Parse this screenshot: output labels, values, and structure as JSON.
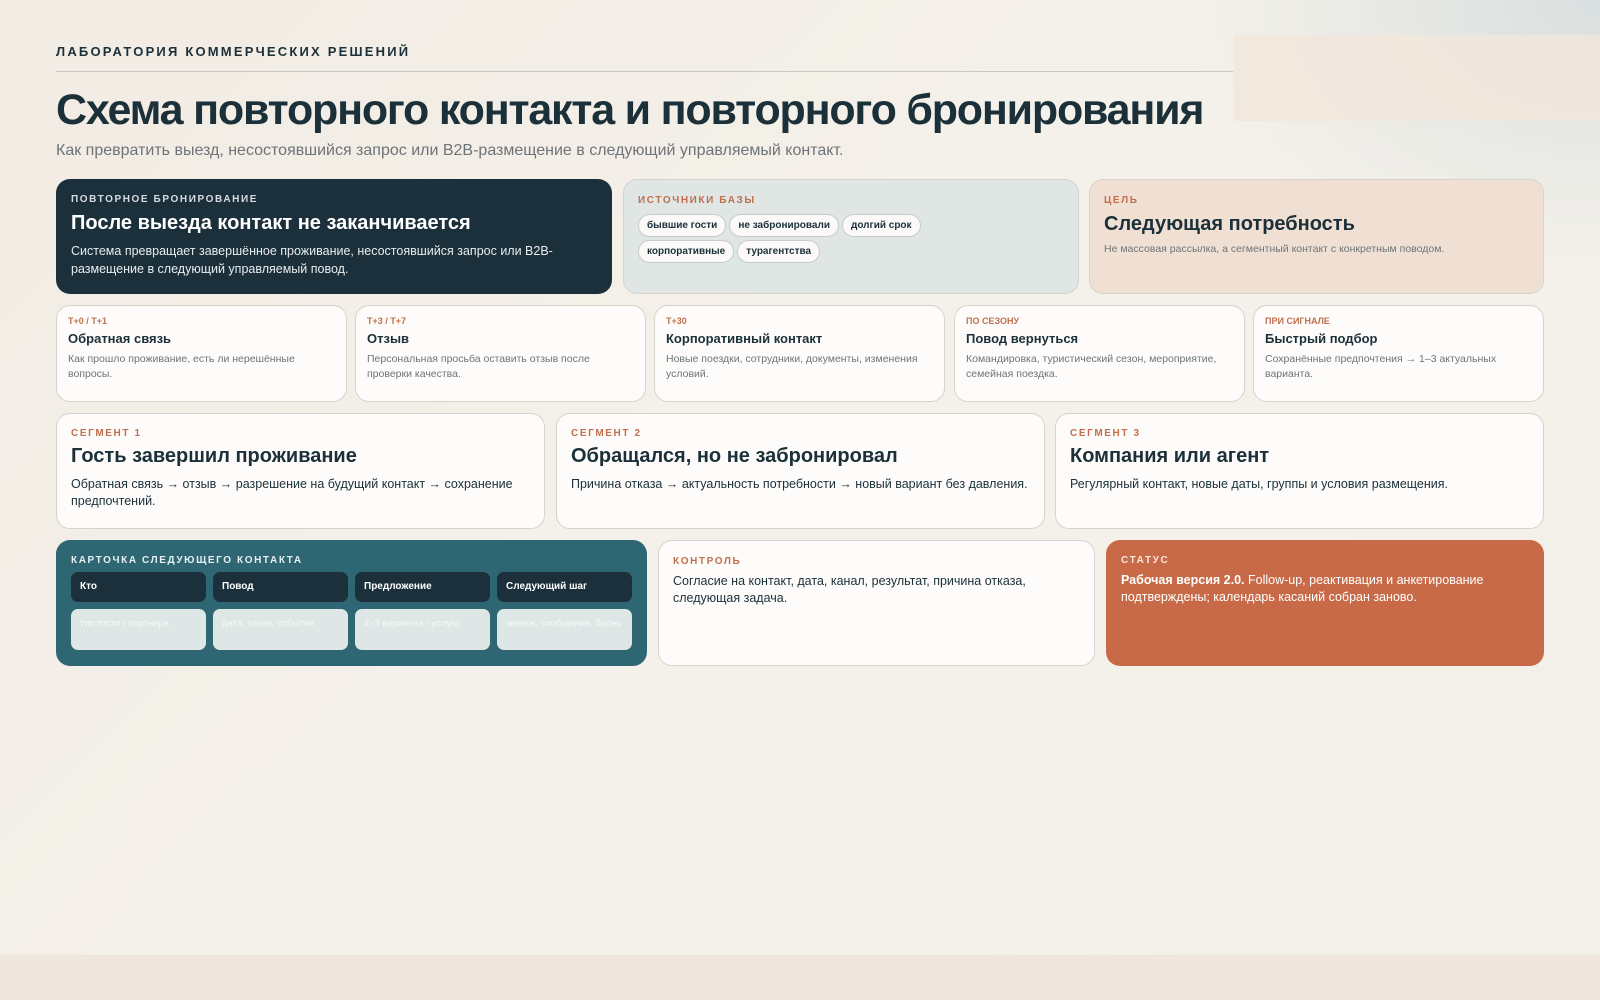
{
  "header": {
    "eyebrow": "ЛАБОРАТОРИЯ КОММЕРЧЕСКИХ РЕШЕНИЙ",
    "title": "Схема повторного контакта и повторного бронирования",
    "subtitle": "Как превратить выезд, несостоявшийся запрос или B2B-размещение в следующий управляемый контакт."
  },
  "hero": {
    "label": "ПОВТОРНОЕ БРОНИРОВАНИЕ",
    "title": "После выезда контакт не заканчивается",
    "text": "Система превращает завершённое проживание, несостоявшийся запрос или B2B-размещение в следующий управляемый повод."
  },
  "sources": {
    "label": "ИСТОЧНИКИ БАЗЫ",
    "chips": [
      "бывшие гости",
      "не забронировали",
      "долгий срок",
      "корпоративные",
      "турагентства"
    ]
  },
  "goal": {
    "label": "ЦЕЛЬ",
    "title": "Следующая потребность",
    "text": "Не массовая рассылка, а сегментный контакт с конкретным поводом."
  },
  "steps": [
    {
      "label": "T+0 / T+1",
      "title": "Обратная связь",
      "text": "Как прошло проживание, есть ли нерешённые вопросы."
    },
    {
      "label": "T+3 / T+7",
      "title": "Отзыв",
      "text": "Персональная просьба оставить отзыв после проверки качества."
    },
    {
      "label": "T+30",
      "title": "Корпоративный контакт",
      "text": "Новые поездки, сотрудники, документы, изменения условий."
    },
    {
      "label": "ПО СЕЗОНУ",
      "title": "Повод вернуться",
      "text": "Командировка, туристический сезон, мероприятие, семейная поездка."
    },
    {
      "label": "ПРИ СИГНАЛЕ",
      "title": "Быстрый подбор",
      "text": "Сохранённые предпочтения → 1–3 актуальных варианта."
    }
  ],
  "segments": [
    {
      "label": "СЕГМЕНТ 1",
      "title": "Гость завершил проживание",
      "text": "Обратная связь → отзыв → разрешение на будущий контакт → сохранение предпочтений."
    },
    {
      "label": "СЕГМЕНТ 2",
      "title": "Обращался, но не забронировал",
      "text": "Причина отказа → актуальность потребности → новый вариант без давления."
    },
    {
      "label": "СЕГМЕНТ 3",
      "title": "Компания или агент",
      "text": "Регулярный контакт, новые даты, группы и условия размещения."
    }
  ],
  "next_card": {
    "label": "КАРТОЧКА СЛЕДУЮЩЕГО КОНТАКТА",
    "columns": [
      {
        "head": "Кто",
        "cell": "тип гостя / партнёра"
      },
      {
        "head": "Повод",
        "cell": "дата, сезон, событие"
      },
      {
        "head": "Предложение",
        "cell": "1–3 варианта / услуга"
      },
      {
        "head": "Следующий шаг",
        "cell": "звонок, сообщение, бронь"
      }
    ]
  },
  "control": {
    "label": "КОНТРОЛЬ",
    "text": "Согласие на контакт, дата, канал, результат, причина отказа, следующая задача."
  },
  "status": {
    "label": "СТАТУС",
    "bold": "Рабочая версия 2.0.",
    "text": " Follow-up, реактивация и анкетирование подтверждены; календарь касаний собран заново."
  },
  "colors": {
    "navy": "#1b303b",
    "teal": "#2e6773",
    "accent": "#c86a47",
    "label_orange": "#c0704d"
  }
}
